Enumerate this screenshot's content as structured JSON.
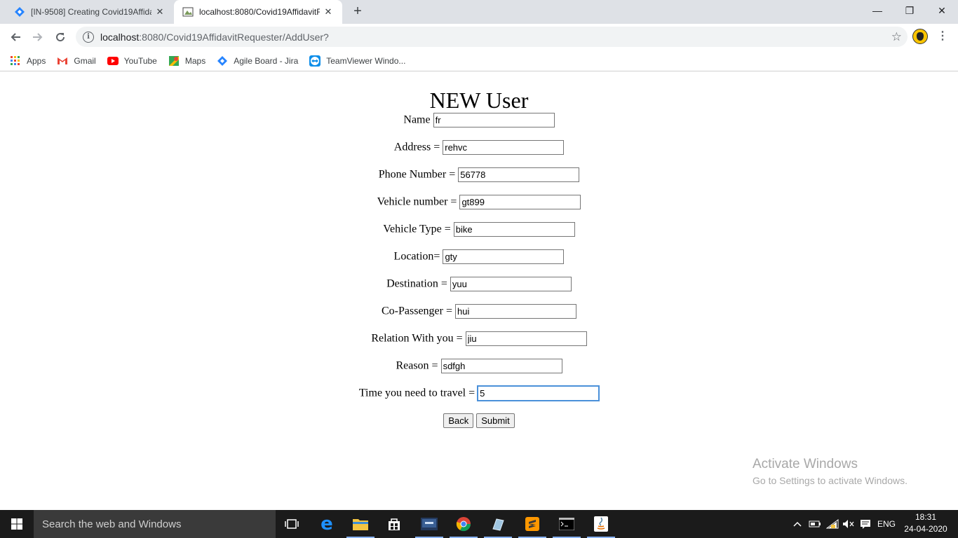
{
  "browser": {
    "tabs": [
      {
        "title": "[IN-9508] Creating Covid19Affida",
        "close": "✕"
      },
      {
        "title": "localhost:8080/Covid19AffidavitR",
        "close": "✕"
      }
    ],
    "new_tab": "+",
    "window_controls": {
      "minimize": "—",
      "maximize": "❐",
      "close": "✕"
    },
    "url_host": "localhost",
    "url_rest": ":8080/Covid19AffidavitRequester/AddUser?",
    "bookmarks": [
      {
        "label": "Apps",
        "icon": "apps-grid-icon"
      },
      {
        "label": "Gmail",
        "icon": "gmail-icon"
      },
      {
        "label": "YouTube",
        "icon": "youtube-icon"
      },
      {
        "label": "Maps",
        "icon": "maps-icon"
      },
      {
        "label": "Agile Board - Jira",
        "icon": "jira-icon"
      },
      {
        "label": "TeamViewer Windo...",
        "icon": "teamviewer-icon"
      }
    ]
  },
  "form": {
    "title": "NEW User",
    "fields": [
      {
        "label": "Name",
        "value": "fr"
      },
      {
        "label": "Address =",
        "value": "rehvc"
      },
      {
        "label": "Phone Number =",
        "value": "56778"
      },
      {
        "label": "Vehicle number =",
        "value": "gt899"
      },
      {
        "label": "Vehicle Type =",
        "value": "bike"
      },
      {
        "label": "Location=",
        "value": "gty"
      },
      {
        "label": "Destination =",
        "value": "yuu"
      },
      {
        "label": "Co-Passenger =",
        "value": "hui"
      },
      {
        "label": "Relation With you =",
        "value": "jiu"
      },
      {
        "label": "Reason =",
        "value": "sdfgh"
      },
      {
        "label": "Time you need to travel =",
        "value": "5"
      }
    ],
    "back_label": "Back",
    "submit_label": "Submit"
  },
  "watermark": {
    "line1": "Activate Windows",
    "line2": "Go to Settings to activate Windows."
  },
  "taskbar": {
    "search_placeholder": "Search the web and Windows",
    "language": "ENG",
    "time": "18:31",
    "date": "24-04-2020"
  },
  "colors": {
    "tab_strip": "#dee1e6",
    "omnibox": "#f1f3f4",
    "taskbar": "#1b1b1b",
    "focus_ring": "#4a90d9"
  }
}
